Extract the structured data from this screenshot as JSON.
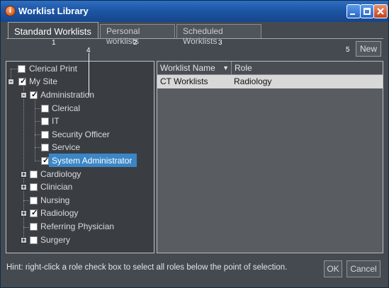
{
  "window": {
    "title": "Worklist Library",
    "app_icon": "info-icon"
  },
  "tabs": [
    {
      "label": "Standard Worklists",
      "active": true
    },
    {
      "label": "Personal worklists",
      "active": false
    },
    {
      "label": "Scheduled Worklists",
      "active": false
    }
  ],
  "callouts": [
    "1",
    "2",
    "3",
    "4",
    "5"
  ],
  "toolbar": {
    "new_label": "New"
  },
  "tree": [
    {
      "label": "Clerical Print",
      "checked": false
    },
    {
      "label": "My Site",
      "checked": true
    },
    {
      "label": "Administration",
      "checked": true
    },
    {
      "label": "Clerical",
      "checked": false
    },
    {
      "label": "IT",
      "checked": false
    },
    {
      "label": "Security Officer",
      "checked": false
    },
    {
      "label": "Service",
      "checked": false
    },
    {
      "label": "System Administrator",
      "checked": true,
      "selected": true
    },
    {
      "label": "Cardiology",
      "checked": false
    },
    {
      "label": "Clinician",
      "checked": false
    },
    {
      "label": "Nursing",
      "checked": false
    },
    {
      "label": "Radiology",
      "checked": true
    },
    {
      "label": "Referring Physician",
      "checked": false
    },
    {
      "label": "Surgery",
      "checked": false
    }
  ],
  "grid": {
    "columns": [
      "Worklist Name",
      "Role"
    ],
    "rows": [
      [
        "CT Worklists",
        "Radiology"
      ]
    ]
  },
  "footer": {
    "hint": "Hint: right-click a role check box to select all roles below the point of selection.",
    "ok_label": "OK",
    "cancel_label": "Cancel"
  },
  "colors": {
    "selection": "#3b86c6",
    "titlebar": "#1d56a6",
    "panel": "#454a50"
  }
}
